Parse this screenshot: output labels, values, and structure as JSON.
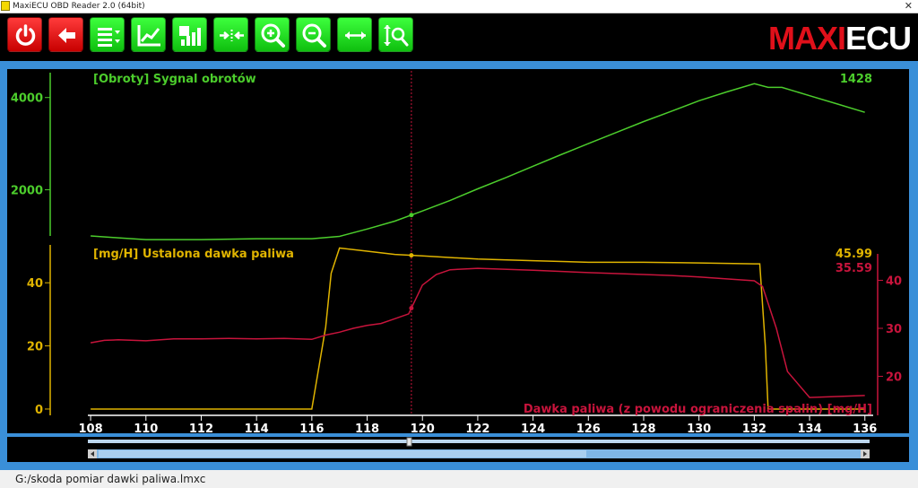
{
  "window": {
    "title": "MaxiECU OBD Reader 2.0 (64bit)"
  },
  "toolbar": {
    "buttons": [
      {
        "name": "power-icon"
      },
      {
        "name": "back-arrow-icon"
      },
      {
        "name": "list-settings-icon"
      },
      {
        "name": "line-chart-icon"
      },
      {
        "name": "bar-chart-icon"
      },
      {
        "name": "compress-icon"
      },
      {
        "name": "zoom-in-icon"
      },
      {
        "name": "zoom-out-icon"
      },
      {
        "name": "expand-horizontal-icon"
      },
      {
        "name": "zoom-fit-icon"
      }
    ],
    "logo_maxi": "MAXI",
    "logo_ecu": "ECU"
  },
  "colors": {
    "rpm": "#4ccd2c",
    "fuel_set": "#e0b400",
    "fuel_limit": "#c8143c",
    "cursor": "#c8143c"
  },
  "chart_data": [
    {
      "type": "line",
      "title": "[Obroty] Sygnal obrotów",
      "current_value": "1428",
      "y_ticks": [
        "4000",
        "2000"
      ],
      "ylim": [
        1000,
        4500
      ],
      "x": [
        108,
        109,
        110,
        111,
        112,
        113,
        114,
        115,
        116,
        117,
        118,
        119,
        120,
        121,
        122,
        123,
        124,
        125,
        126,
        127,
        128,
        129,
        130,
        131,
        132,
        132.5,
        133,
        134,
        135,
        136
      ],
      "series": [
        {
          "values": [
            1000,
            960,
            920,
            920,
            920,
            930,
            940,
            940,
            940,
            990,
            1150,
            1320,
            1540,
            1770,
            2020,
            2260,
            2510,
            2760,
            3000,
            3240,
            3480,
            3700,
            3930,
            4120,
            4300,
            4220,
            4220,
            4040,
            3860,
            3680
          ]
        }
      ]
    },
    {
      "type": "line",
      "title": "[mg/H] Ustalona dawka paliwa",
      "current_value": "45.99",
      "y_ticks": [
        "40",
        "20",
        "0"
      ],
      "ylim": [
        -2,
        52
      ],
      "x": [
        108,
        116,
        116.5,
        116.7,
        117,
        118,
        119,
        120,
        122,
        124,
        126,
        128,
        130,
        132,
        132.2,
        132.4,
        132.5,
        136
      ],
      "series": [
        {
          "values": [
            0,
            0,
            26,
            43,
            51,
            50,
            49,
            48.5,
            47.5,
            47,
            46.5,
            46.5,
            46.3,
            46,
            46,
            20,
            0,
            0
          ]
        }
      ]
    },
    {
      "type": "line",
      "title": "Dawka paliwa (z powodu ograniczenia spalin) [mg/H]",
      "current_value": "35.59",
      "y_ticks": [
        "40",
        "30",
        "20"
      ],
      "ylim": [
        13,
        47
      ],
      "x": [
        108,
        108.5,
        109,
        110,
        111,
        112,
        113,
        114,
        115,
        116,
        116.5,
        117,
        117.5,
        118,
        118.5,
        119,
        119.5,
        120,
        120.5,
        121,
        122,
        124,
        126,
        128,
        129,
        130,
        131,
        132,
        132.3,
        132.8,
        133.2,
        134,
        135,
        136
      ],
      "series": [
        {
          "values": [
            27,
            27.5,
            27.6,
            27.4,
            27.8,
            27.8,
            27.9,
            27.8,
            27.9,
            27.7,
            28.6,
            29.2,
            30.0,
            30.6,
            31.0,
            32.0,
            33.0,
            39.0,
            41.2,
            42.2,
            42.5,
            42.1,
            41.6,
            41.2,
            41.0,
            40.7,
            40.3,
            39.9,
            38.7,
            30.0,
            21.0,
            15.6,
            15.8,
            16.0
          ]
        }
      ]
    }
  ],
  "x_axis": {
    "ticks": [
      "108",
      "110",
      "112",
      "114",
      "116",
      "118",
      "120",
      "122",
      "124",
      "126",
      "128",
      "130",
      "132",
      "134",
      "136"
    ],
    "xlim": [
      107.9,
      136.3
    ]
  },
  "cursor_x": 119.6,
  "statusbar": {
    "file_path": "G:/skoda pomiar dawki paliwa.lmxc"
  }
}
